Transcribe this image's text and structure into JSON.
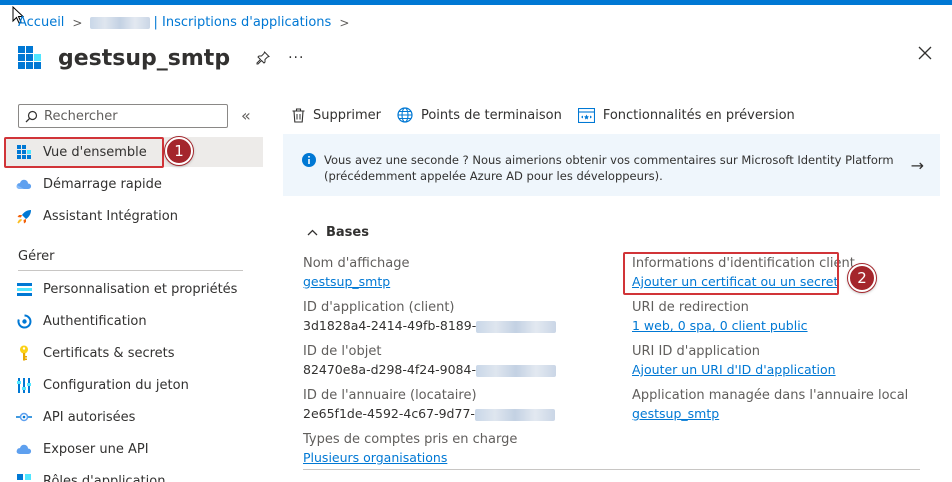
{
  "breadcrumb": {
    "home": "Accueil",
    "current": "| Inscriptions d'applications"
  },
  "header": {
    "title": "gestsup_smtp"
  },
  "sidebar": {
    "search_placeholder": "Rechercher",
    "items_top": [
      {
        "label": "Vue d'ensemble",
        "icon": "grid-icon",
        "active": true
      },
      {
        "label": "Démarrage rapide",
        "icon": "cloud-icon"
      },
      {
        "label": "Assistant Intégration",
        "icon": "rocket-icon"
      }
    ],
    "section_label": "Gérer",
    "items_manage": [
      {
        "label": "Personnalisation et propriétés",
        "icon": "branding-icon"
      },
      {
        "label": "Authentification",
        "icon": "authentication-icon"
      },
      {
        "label": "Certificats & secrets",
        "icon": "key-icon"
      },
      {
        "label": "Configuration du jeton",
        "icon": "token-icon"
      },
      {
        "label": "API autorisées",
        "icon": "api-permissions-icon"
      },
      {
        "label": "Exposer une API",
        "icon": "cloud-api-icon"
      },
      {
        "label": "Rôles d'application",
        "icon": "app-roles-icon"
      }
    ]
  },
  "toolbar": {
    "delete_label": "Supprimer",
    "endpoints_label": "Points de terminaison",
    "preview_label": "Fonctionnalités en préversion"
  },
  "banner": {
    "line1": "Vous avez une seconde ? Nous aimerions obtenir vos commentaires sur Microsoft Identity Platform",
    "line2": "(précédemment appelée Azure AD pour les développeurs)."
  },
  "essentials": {
    "heading": "Bases",
    "display_name_label": "Nom d'affichage",
    "display_name_value": "gestsup_smtp",
    "app_id_label": "ID d'application (client)",
    "app_id_value": "3d1828a4-2414-49fb-8189-",
    "object_id_label": "ID de l'objet",
    "object_id_value": "82470e8a-d298-4f24-9084-",
    "tenant_id_label": "ID de l'annuaire (locataire)",
    "tenant_id_value": "2e65f1de-4592-4c67-9d77-",
    "account_types_label": "Types de comptes pris en charge",
    "account_types_value": "Plusieurs organisations",
    "credentials_label": "Informations d'identification client",
    "credentials_value": "Ajouter un certificat ou un secret",
    "redirect_label": "URI de redirection",
    "redirect_value": "1 web, 0 spa, 0 client public",
    "app_id_uri_label": "URI ID d'application",
    "app_id_uri_value": "Ajouter un URI d'ID d'application",
    "managed_app_label": "Application managée dans l'annuaire local",
    "managed_app_value": "gestsup_smtp"
  },
  "annotations": {
    "marker1": "1",
    "marker2": "2"
  },
  "colors": {
    "accent": "#0078d4",
    "annotation_red": "#d13438",
    "marker_fill": "#a4262c",
    "banner_bg": "#eff6fc",
    "active_nav_bg": "#edebe9"
  }
}
